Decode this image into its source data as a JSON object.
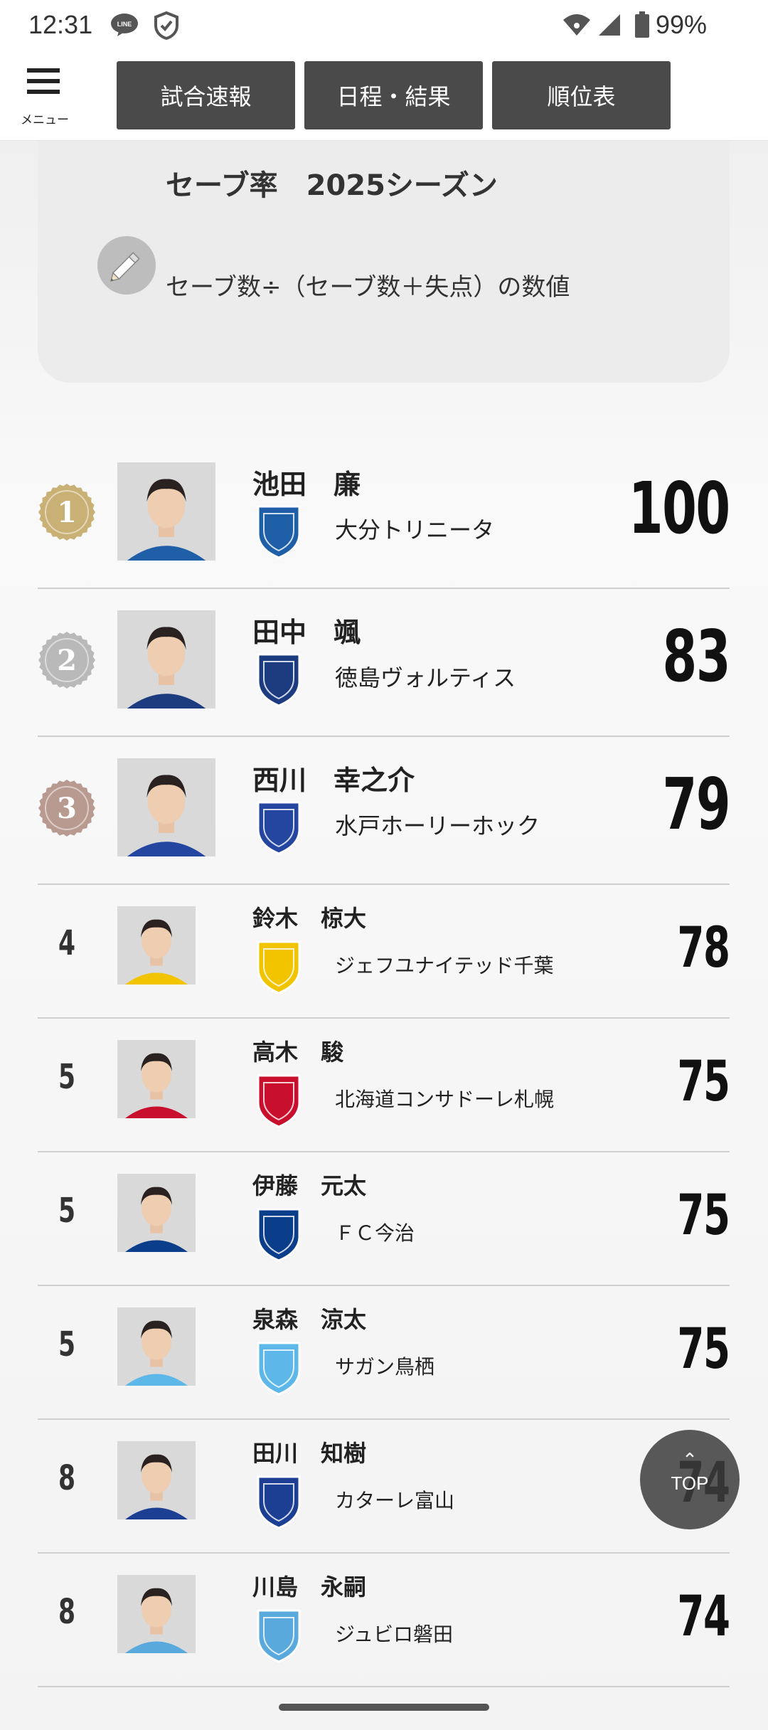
{
  "status_bar": {
    "time": "12:31",
    "battery": "99%"
  },
  "menu": {
    "label": "メニュー"
  },
  "nav_tabs": [
    {
      "label": "試合速報"
    },
    {
      "label": "日程・結果"
    },
    {
      "label": "順位表"
    }
  ],
  "card": {
    "title": "セーブ率　2025シーズン",
    "formula": "セーブ数÷（セーブ数＋失点）の数値"
  },
  "rankings": [
    {
      "rank": "1",
      "name": "池田　廉",
      "team": "大分トリニータ",
      "rate": "100",
      "medal": "gold",
      "team_color": "#1f5fa8"
    },
    {
      "rank": "2",
      "name": "田中　颯",
      "team": "徳島ヴォルティス",
      "rate": "83",
      "medal": "silver",
      "team_color": "#1d3c80"
    },
    {
      "rank": "3",
      "name": "西川　幸之介",
      "team": "水戸ホーリーホック",
      "rate": "79",
      "medal": "bronze",
      "team_color": "#2446a0"
    },
    {
      "rank": "4",
      "name": "鈴木　椋大",
      "team": "ジェフユナイテッド千葉",
      "rate": "78",
      "medal": "",
      "team_color": "#f2c400"
    },
    {
      "rank": "5",
      "name": "高木　駿",
      "team": "北海道コンサドーレ札幌",
      "rate": "75",
      "medal": "",
      "team_color": "#c8102e"
    },
    {
      "rank": "5",
      "name": "伊藤　元太",
      "team": "ＦＣ今治",
      "rate": "75",
      "medal": "",
      "team_color": "#0a3d8a"
    },
    {
      "rank": "5",
      "name": "泉森　涼太",
      "team": "サガン鳥栖",
      "rate": "75",
      "medal": "",
      "team_color": "#5db7e8"
    },
    {
      "rank": "8",
      "name": "田川　知樹",
      "team": "カターレ富山",
      "rate": "74",
      "medal": "",
      "team_color": "#1c3f94"
    },
    {
      "rank": "8",
      "name": "川島　永嗣",
      "team": "ジュビロ磐田",
      "rate": "74",
      "medal": "",
      "team_color": "#5aa9dc"
    }
  ],
  "top_button": {
    "label": "TOP"
  },
  "colors": {
    "nav_bg": "#4a4a4a",
    "card_bg": "#ececec",
    "gold": "#c9b074",
    "silver": "#b9b9b9",
    "bronze": "#b99a90"
  }
}
